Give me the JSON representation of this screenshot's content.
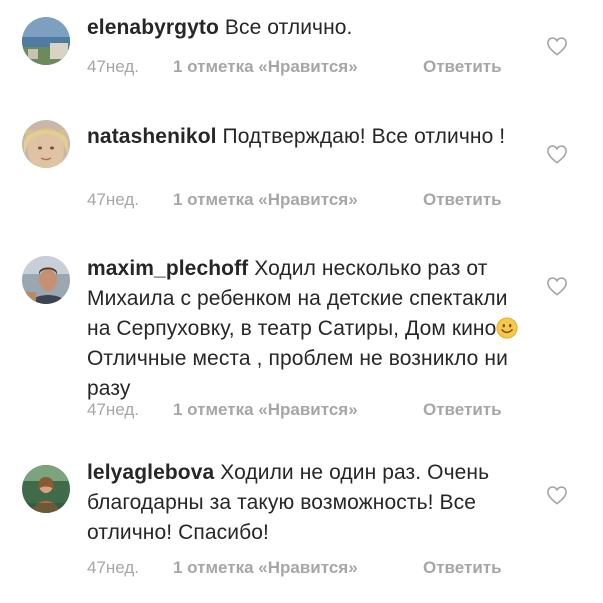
{
  "comments": [
    {
      "username": "elenabyrgyto",
      "text": "Все отлично.",
      "time": "47нед.",
      "likes": "1 отметка «Нравится»",
      "reply": "Ответить",
      "avatar": "seaside-avatar"
    },
    {
      "username": "natashenikol",
      "text": "Подтверждаю! Все отлично !",
      "time": "47нед.",
      "likes": "1 отметка «Нравится»",
      "reply": "Ответить",
      "avatar": "woman-portrait-avatar"
    },
    {
      "username": "maxim_plechoff",
      "text_before_emoji": "Ходил несколько раз от Михаила с ребенком на детские спектакли на Серпуховку, в театр Сатиры, Дом кино",
      "emoji": "smiling-face-emoji",
      "text_after_emoji": " Отличные места , проблем не возникло ни разу",
      "time": "47нед.",
      "likes": "1 отметка «Нравится»",
      "reply": "Ответить",
      "avatar": "man-portrait-avatar"
    },
    {
      "username": "lelyaglebova",
      "text": "Ходили не один раз. Очень благодарны за такую возможность! Все отлично! Спасибо!",
      "time": "47нед.",
      "likes": "1 отметка «Нравится»",
      "reply": "Ответить",
      "avatar": "woman-outdoor-avatar"
    }
  ],
  "icons": {
    "like": "heart-outline-icon"
  },
  "colors": {
    "text": "#262626",
    "meta": "#a6a6a6",
    "background": "#ffffff"
  }
}
